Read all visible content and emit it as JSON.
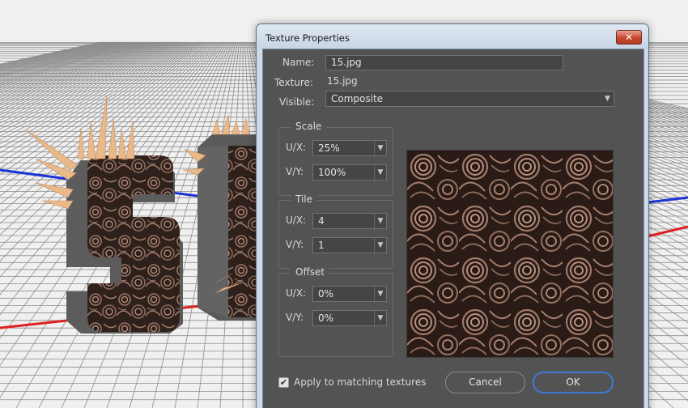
{
  "dialog": {
    "title": "Texture Properties",
    "close_label": "✕",
    "name_label": "Name:",
    "name_value": "15.jpg",
    "texture_label": "Texture:",
    "texture_value": "15.jpg",
    "visible_label": "Visible:",
    "visible_value": "Composite",
    "scale": {
      "title": "Scale",
      "ux_label": "U/X:",
      "ux_value": "25%",
      "vy_label": "V/Y:",
      "vy_value": "100%"
    },
    "tile": {
      "title": "Tile",
      "ux_label": "U/X:",
      "ux_value": "4",
      "vy_label": "V/Y:",
      "vy_value": "1"
    },
    "offset": {
      "title": "Offset",
      "ux_label": "U/X:",
      "ux_value": "0%",
      "vy_label": "V/Y:",
      "vy_value": "0%"
    },
    "apply_checkbox": {
      "label": "Apply to matching textures",
      "checked": true
    },
    "cancel_label": "Cancel",
    "ok_label": "OK"
  },
  "colors": {
    "dialog_bg": "#535353",
    "window_frame": "#ced9e6",
    "close_red": "#c8472f",
    "ok_focus_blue": "#3f78d6",
    "x_axis_red": "#e02020",
    "z_axis_blue": "#1a33d6",
    "spike_color": "#e9b98a",
    "letter_side": "#5c5c5c"
  },
  "icons": {
    "close": "close-icon",
    "dropdown": "chevron-down-icon",
    "check": "checkmark-icon"
  }
}
